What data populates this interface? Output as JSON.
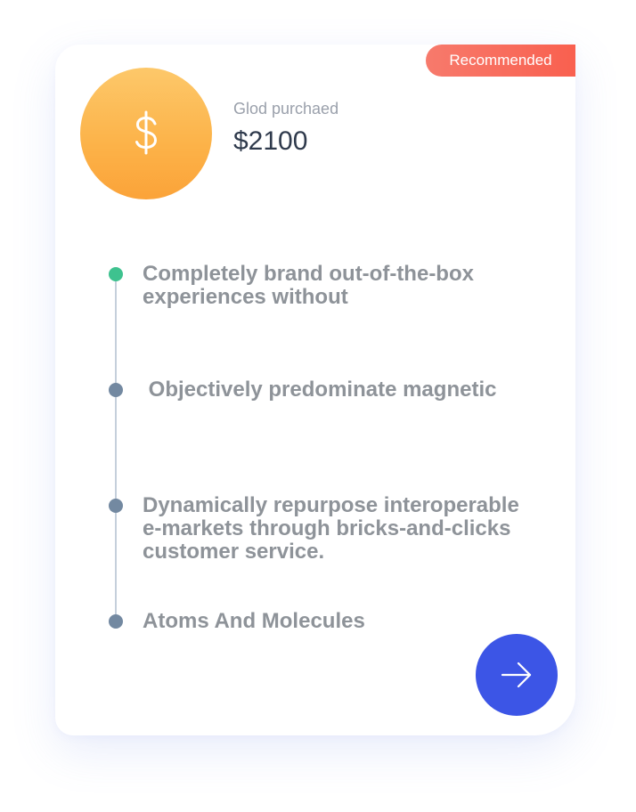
{
  "badge": {
    "label": "Recommended",
    "color": "#f96a5b"
  },
  "purchase": {
    "icon": "dollar-icon",
    "label": "Glod purchaed",
    "amount": "$2100",
    "coin_color": "#fcb248"
  },
  "features": [
    {
      "text": "Completely brand out-of-the-box experiences without",
      "active": true
    },
    {
      "text": " Objectively predominate magnetic",
      "active": false
    },
    {
      "text": "Dynamically repurpose interoperable e-markets through bricks-and-clicks customer service.",
      "active": false
    },
    {
      "text": "Atoms And Molecules",
      "active": false
    }
  ],
  "next_button": {
    "icon": "arrow-right-icon",
    "color": "#3c55e6"
  },
  "colors": {
    "active_dot": "#3ec28f",
    "inactive_dot": "#7389a1",
    "text": "#8e9399",
    "amount": "#2f3a4c"
  }
}
